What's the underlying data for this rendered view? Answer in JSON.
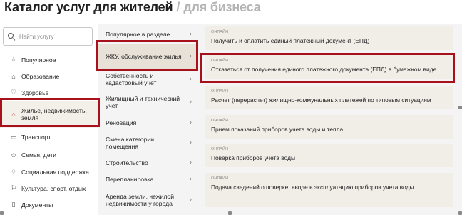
{
  "header": {
    "title_main": "Каталог услуг для жителей",
    "separator": "/",
    "title_alt": "для бизнеса"
  },
  "search": {
    "placeholder": "Найти услугу",
    "icon": "search-icon"
  },
  "categories": [
    {
      "label": "Популярное",
      "icon": "star-icon"
    },
    {
      "label": "Образование",
      "icon": "graduation-cap-icon"
    },
    {
      "label": "Здоровье",
      "icon": "heart-icon"
    },
    {
      "label": "Жилье, недвижимость, земля",
      "icon": "house-icon",
      "active": true
    },
    {
      "label": "Транспорт",
      "icon": "bus-icon"
    },
    {
      "label": "Семья, дети",
      "icon": "family-icon"
    },
    {
      "label": "Социальная поддержка",
      "icon": "support-icon"
    },
    {
      "label": "Культура, спорт, отдых",
      "icon": "culture-icon"
    },
    {
      "label": "Документы",
      "icon": "document-icon"
    }
  ],
  "subcategories": [
    {
      "label": "Популярное в разделе"
    },
    {
      "label": "ЖКУ, обслуживание жилья",
      "active": true
    },
    {
      "label": "Собственность и кадастровый учет"
    },
    {
      "label": "Жилищный и технический учет"
    },
    {
      "label": "Реновация"
    },
    {
      "label": "Смена категории помещения"
    },
    {
      "label": "Строительство"
    },
    {
      "label": "Перепланировка"
    },
    {
      "label": "Аренда земли, нежилой недвижимости у города"
    }
  ],
  "services": [
    {
      "tag": "ОНЛАЙН",
      "name": "Получить и оплатить единый платежный документ (ЕПД)"
    },
    {
      "tag": "ОНЛАЙН",
      "name": "Отказаться от получения единого платежного документа (ЕПД) в бумажном виде"
    },
    {
      "tag": "ОНЛАЙН",
      "name": "Расчет (перерасчет) жилищно-коммунальных платежей по типовым ситуациям"
    },
    {
      "tag": "ОНЛАЙН",
      "name": "Прием показаний приборов учета воды и тепла"
    },
    {
      "tag": "ОНЛАЙН",
      "name": "Поверка приборов учета воды"
    },
    {
      "tag": "ОНЛАЙН",
      "name": "Подача сведений о поверке, вводе в эксплуатацию приборов учета воды"
    }
  ],
  "colors": {
    "highlight": "#a8101b",
    "accent": "#c0392b"
  }
}
